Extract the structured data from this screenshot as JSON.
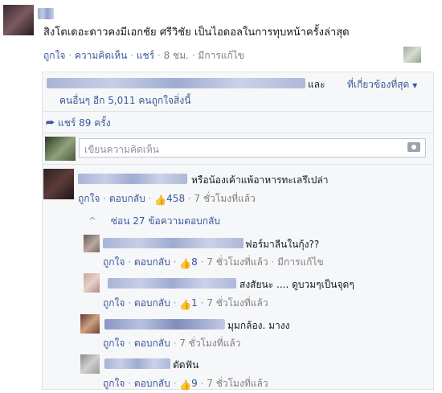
{
  "post": {
    "text": "สิงโตเดอะดาวคงมีเอกชัย ศรีวิชัย เป็นไอดอลในการทุบหน้าครั้งล่าสุด",
    "like": "ถูกใจ",
    "comment": "ความคิดเห็น",
    "share": "แชร์",
    "time": "8 ชม.",
    "edited": "มีการแก้ไข"
  },
  "likes": {
    "and": "และ",
    "others": "คนอื่นๆ อีก 5,011 คนถูกใจสิ่งนี้",
    "relevant": "ที่เกี่ยวข้องที่สุด"
  },
  "shares": {
    "text": "แชร์ 89 ครั้ง"
  },
  "comment_box": {
    "placeholder": "เขียนความคิดเห็น"
  },
  "comments": [
    {
      "text": "หรือน้องเค้าแพ้อาหารทะเลรึเปล่า",
      "like": "ถูกใจ",
      "reply": "ตอบกลับ",
      "likes": "458",
      "time": "7 ชั่วโมงที่แล้ว"
    }
  ],
  "hidden_replies": {
    "text": "ซ่อน 27 ข้อความตอบกลับ"
  },
  "replies": [
    {
      "text": "ฟอร์มาลีนในกุ้ง??",
      "like": "ถูกใจ",
      "reply": "ตอบกลับ",
      "likes": "8",
      "time": "7 ชั่วโมงที่แล้ว",
      "edited": "มีการแก้ไข"
    },
    {
      "text": "สงสัยนะ .... ดูบวมๆเป็นจุดๆ",
      "like": "ถูกใจ",
      "reply": "ตอบกลับ",
      "likes": "1",
      "time": "7 ชั่วโมงที่แล้ว"
    },
    {
      "text": "มุมกล้อง. มางง",
      "like": "ถูกใจ",
      "reply": "ตอบกลับ",
      "time": "7 ชั่วโมงที่แล้ว"
    },
    {
      "text": "ตัดฟัน",
      "like": "ถูกใจ",
      "reply": "ตอบกลับ",
      "likes": "9",
      "time": "7 ชั่วโมงที่แล้ว"
    }
  ],
  "colors": {
    "link": "#3b5998",
    "meta": "#7f7f7f",
    "panel": "#f6f7f9"
  }
}
